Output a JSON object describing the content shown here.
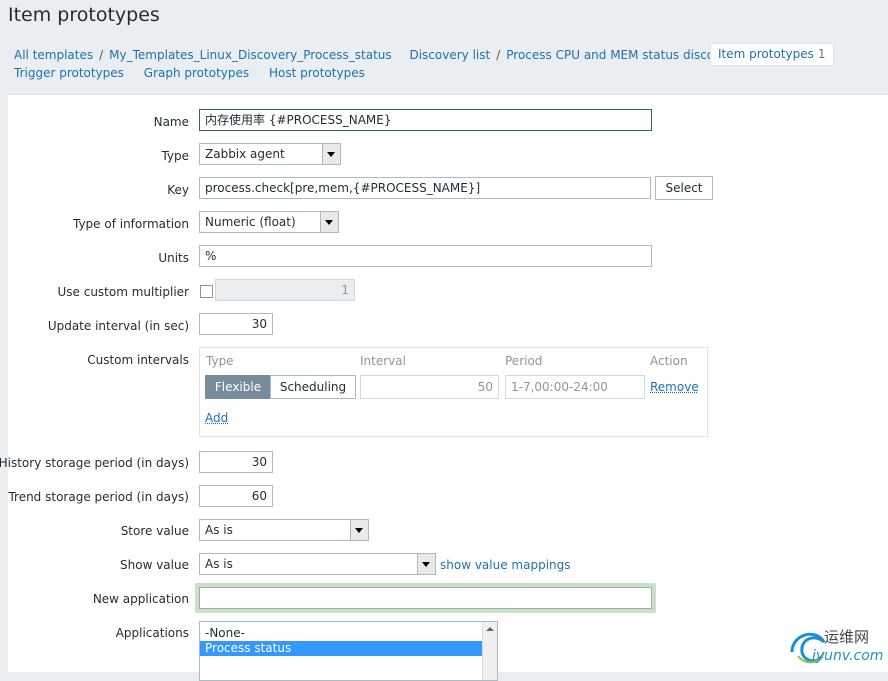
{
  "page": {
    "title": "Item prototypes"
  },
  "breadcrumb": {
    "all_templates": "All templates",
    "template": "My_Templates_Linux_Discovery_Process_status",
    "discovery_list": "Discovery list",
    "discovery_rule": "Process CPU and MEM status discovery",
    "item_prototypes": "Item prototypes",
    "item_prototypes_count": "1",
    "trigger_prototypes": "Trigger prototypes",
    "graph_prototypes": "Graph prototypes",
    "host_prototypes": "Host prototypes"
  },
  "form": {
    "name_label": "Name",
    "name_value": "内存使用率 {#PROCESS_NAME}",
    "type_label": "Type",
    "type_value": "Zabbix agent",
    "key_label": "Key",
    "key_value": "process.check[pre,mem,{#PROCESS_NAME}]",
    "key_select": "Select",
    "info_label": "Type of information",
    "info_value": "Numeric (float)",
    "units_label": "Units",
    "units_value": "%",
    "multiplier_label": "Use custom multiplier",
    "multiplier_value": "1",
    "interval_label": "Update interval (in sec)",
    "interval_value": "30",
    "custom_label": "Custom intervals",
    "custom": {
      "col_type": "Type",
      "col_interval": "Interval",
      "col_period": "Period",
      "col_action": "Action",
      "flexible": "Flexible",
      "scheduling": "Scheduling",
      "interval": "50",
      "period": "1-7,00:00-24:00",
      "remove": "Remove",
      "add": "Add"
    },
    "history_label": "History storage period (in days)",
    "history_value": "30",
    "trend_label": "Trend storage period (in days)",
    "trend_value": "60",
    "store_label": "Store value",
    "store_value": "As is",
    "show_label": "Show value",
    "show_value": "As is",
    "show_mappings": "show value mappings",
    "newapp_label": "New application",
    "newapp_value": "",
    "apps_label": "Applications",
    "apps": [
      "-None-",
      "Process status"
    ]
  },
  "watermark": {
    "cn": "运维网",
    "en": "iyunv.com"
  },
  "colors": {
    "link": "#1f6fb5",
    "accent": "#3399ff",
    "header_bg": "#ebeef0"
  }
}
